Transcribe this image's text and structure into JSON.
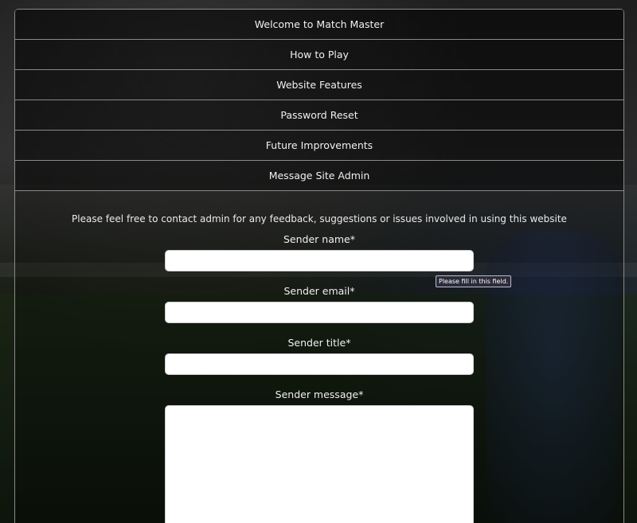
{
  "accordion": {
    "items": [
      {
        "label": "Welcome to Match Master"
      },
      {
        "label": "How to Play"
      },
      {
        "label": "Website Features"
      },
      {
        "label": "Password Reset"
      },
      {
        "label": "Future Improvements"
      },
      {
        "label": "Message Site Admin"
      }
    ]
  },
  "contact": {
    "intro": "Please feel free to contact admin for any feedback, suggestions or issues involved in using this website",
    "fields": {
      "name": {
        "label": "Sender name*",
        "value": "",
        "placeholder": ""
      },
      "email": {
        "label": "Sender email*",
        "value": "",
        "placeholder": ""
      },
      "title": {
        "label": "Sender title*",
        "value": "",
        "placeholder": ""
      },
      "message": {
        "label": "Sender message*",
        "value": "",
        "placeholder": ""
      }
    },
    "validation_tooltip": "Please fill in this field."
  }
}
